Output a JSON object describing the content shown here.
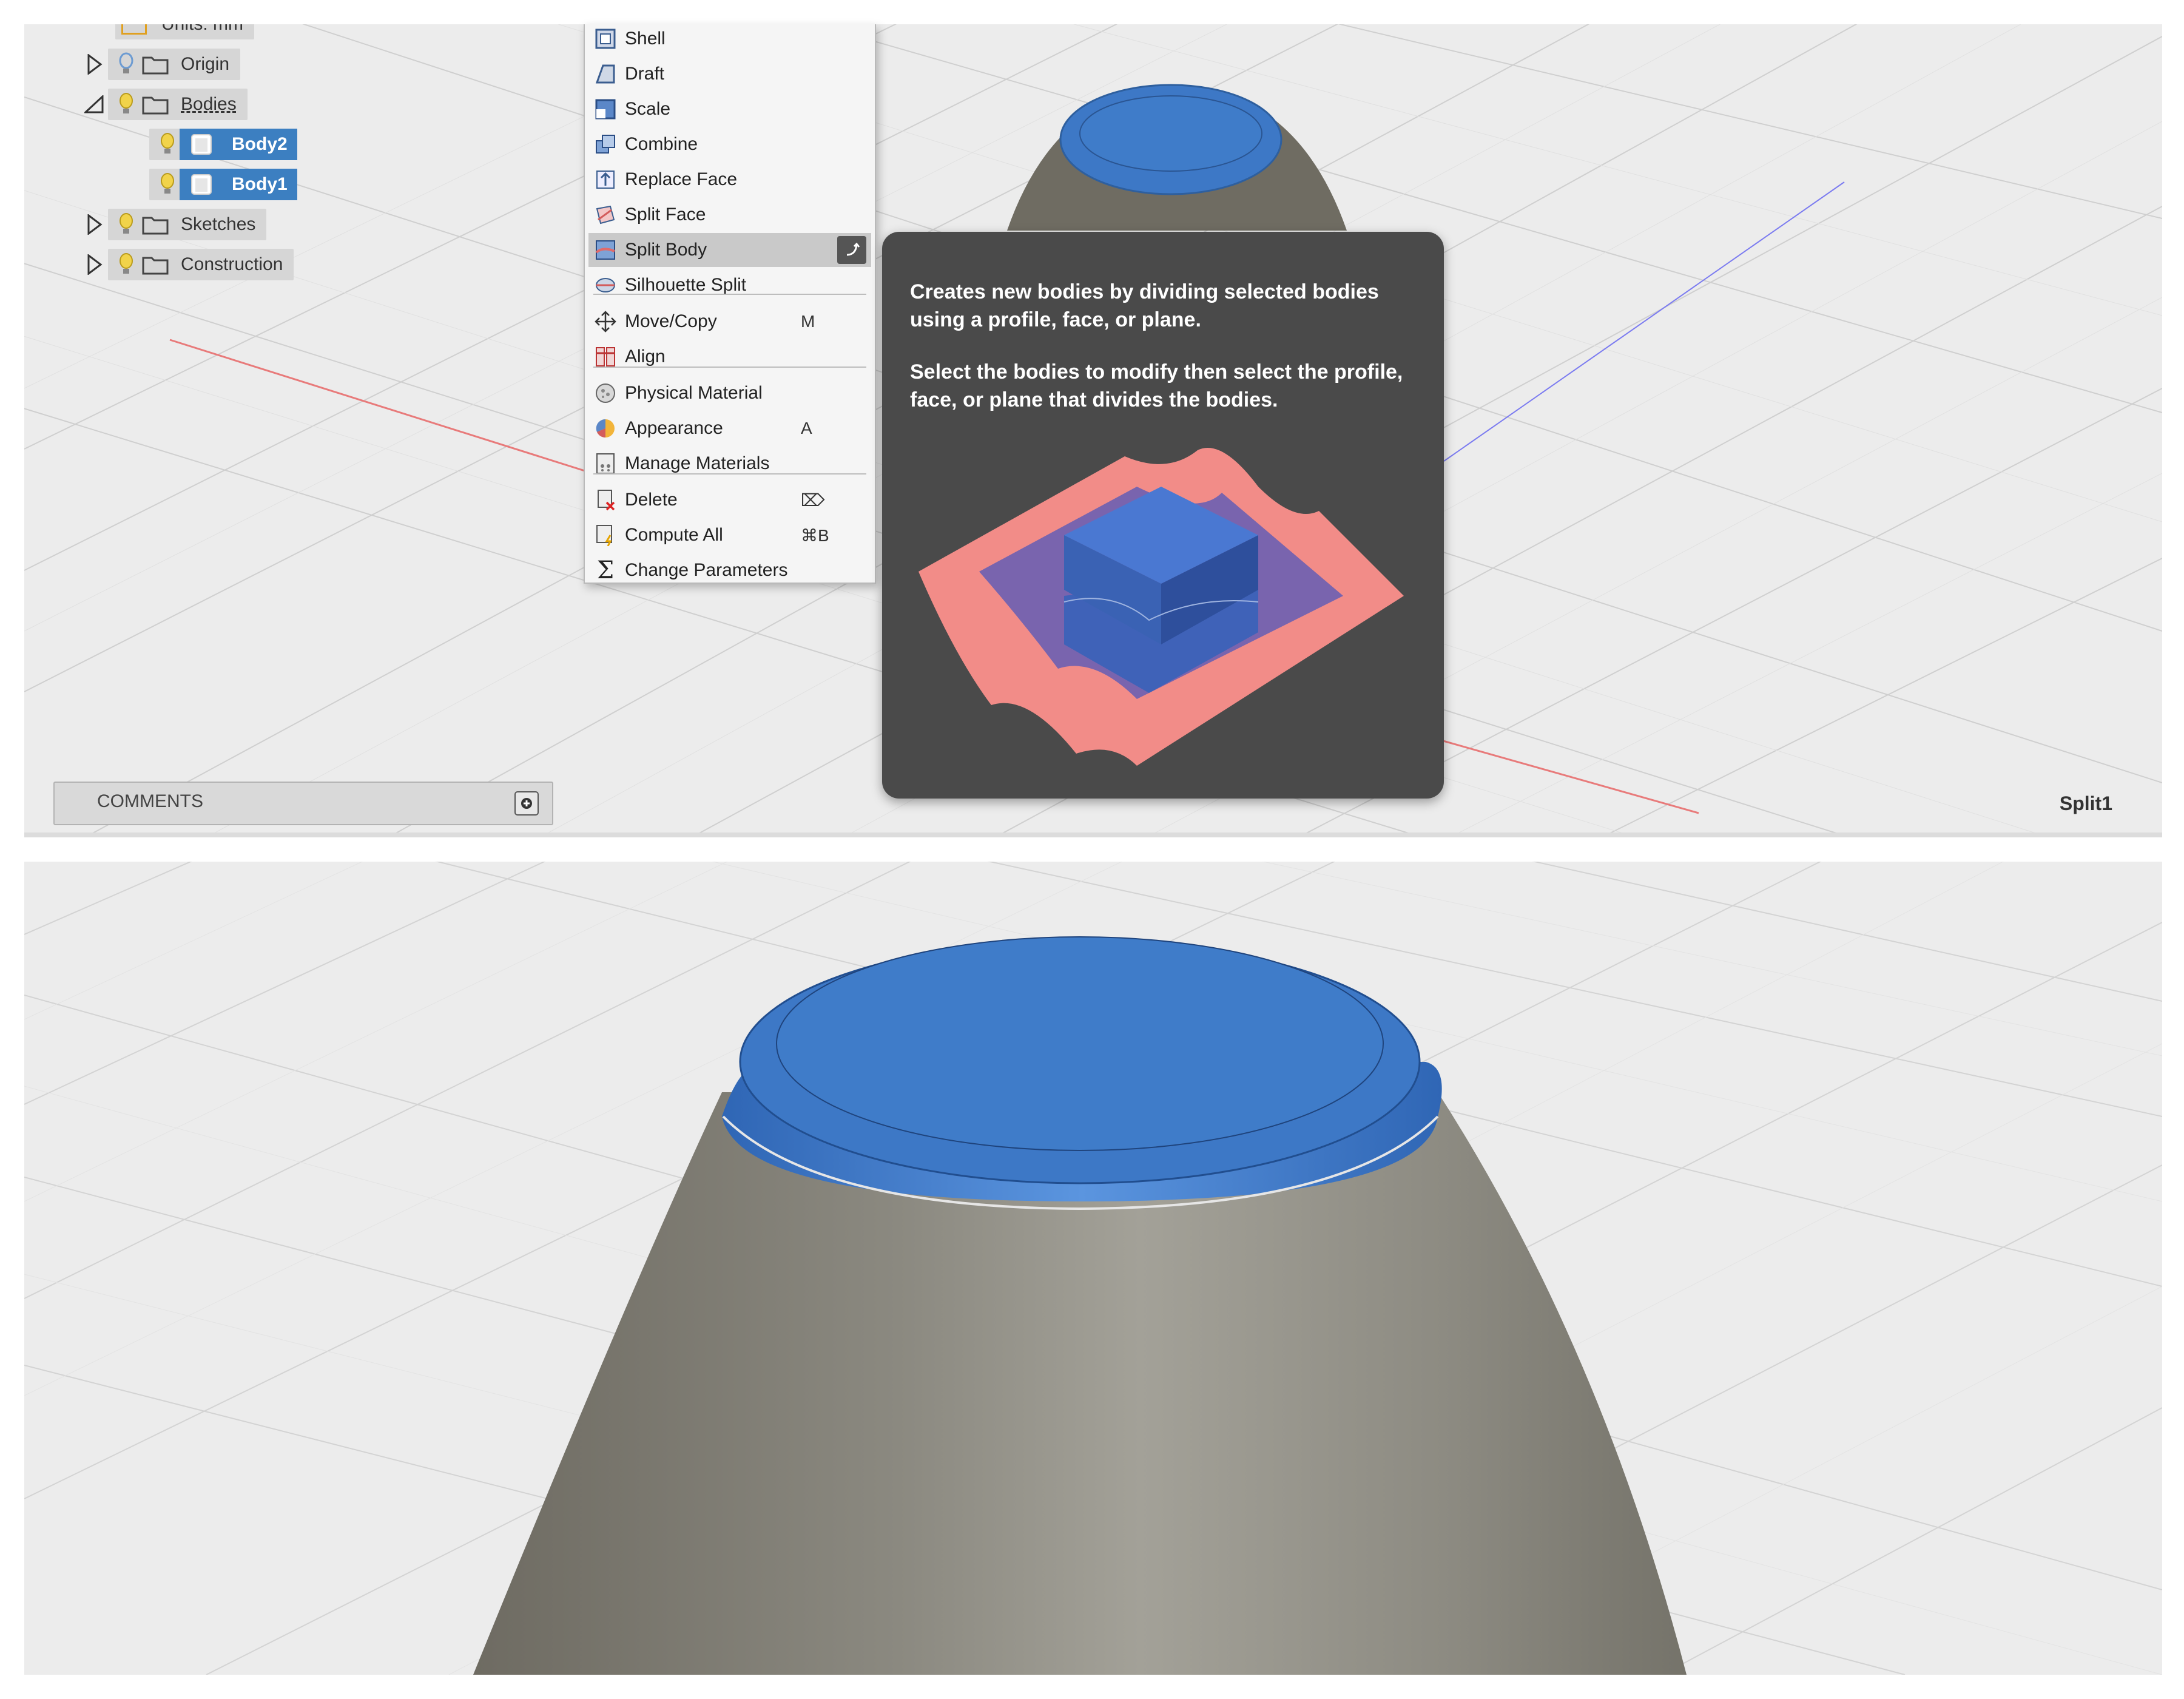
{
  "browser": {
    "units_label": "Units: mm",
    "items": [
      {
        "label": "Origin",
        "bulb": "hidden"
      },
      {
        "label": "Bodies",
        "bulb": "visible"
      },
      {
        "label": "Body2",
        "bulb": "visible",
        "selected": true
      },
      {
        "label": "Body1",
        "bulb": "visible",
        "selected": true
      },
      {
        "label": "Sketches",
        "bulb": "visible"
      },
      {
        "label": "Construction",
        "bulb": "visible"
      }
    ]
  },
  "modify_menu": {
    "items": [
      {
        "label": "Shell",
        "icon": "shell-icon"
      },
      {
        "label": "Draft",
        "icon": "draft-icon"
      },
      {
        "label": "Scale",
        "icon": "scale-icon"
      },
      {
        "label": "Combine",
        "icon": "combine-icon"
      },
      {
        "label": "Replace Face",
        "icon": "replace-face-icon"
      },
      {
        "label": "Split Face",
        "icon": "split-face-icon"
      },
      {
        "label": "Split Body",
        "icon": "split-body-icon",
        "highlighted": true
      },
      {
        "label": "Silhouette Split",
        "icon": "silhouette-split-icon"
      },
      {
        "label": "Move/Copy",
        "icon": "move-icon",
        "shortcut": "M"
      },
      {
        "label": "Align",
        "icon": "align-icon"
      },
      {
        "label": "Physical Material",
        "icon": "physical-material-icon"
      },
      {
        "label": "Appearance",
        "icon": "appearance-icon",
        "shortcut": "A"
      },
      {
        "label": "Manage Materials",
        "icon": "manage-materials-icon"
      },
      {
        "label": "Delete",
        "icon": "delete-icon",
        "shortcut": "⌦"
      },
      {
        "label": "Compute All",
        "icon": "compute-all-icon",
        "shortcut": "⌘B"
      },
      {
        "label": "Change Parameters",
        "icon": "sigma-icon"
      }
    ]
  },
  "tooltip": {
    "line1": "Creates new bodies by dividing selected bodies using a profile, face, or plane.",
    "line2": "Select the bodies to modify then select the profile, face, or plane that divides the bodies."
  },
  "comments": {
    "label": "COMMENTS"
  },
  "status": {
    "feature_name": "Split1"
  },
  "colors": {
    "selection_blue": "#3c7fc1",
    "body_gray": "#8a8a80",
    "tooltip_bg": "#4a4a4a",
    "split_plane_pink": "#f08a86"
  }
}
